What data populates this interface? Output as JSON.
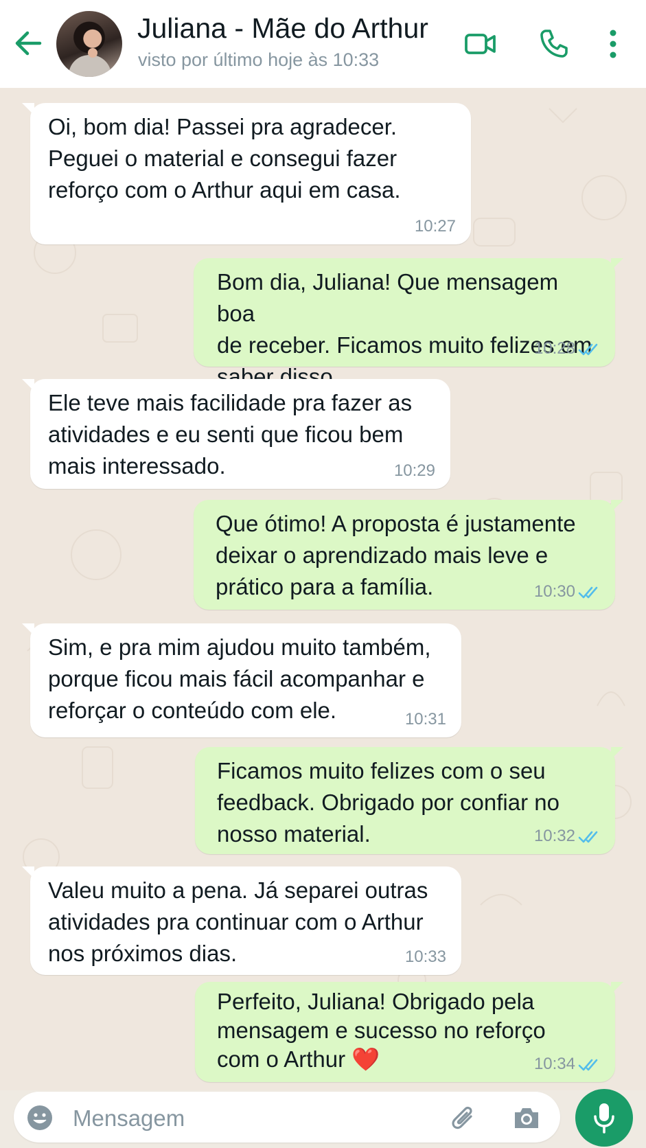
{
  "header": {
    "contact_name": "Juliana - Mãe do Arthur",
    "status": "visto por último hoje às 10:33"
  },
  "theme": {
    "accent": "#1a9c68",
    "incoming_bubble": "#ffffff",
    "outgoing_bubble": "#dcf8c6",
    "read_ticks": "#53bdeb"
  },
  "messages": [
    {
      "dir": "in",
      "text": "Oi, bom dia! Passei pra agradecer.\nPeguei o material e consegui fazer\nreforço com o Arthur aqui em casa.",
      "time": "10:27"
    },
    {
      "dir": "out",
      "text": "Bom dia, Juliana! Que mensagem boa\nde receber. Ficamos muito felizes em\nsaber disso.",
      "time": "10:28",
      "status": "read"
    },
    {
      "dir": "in",
      "text": "Ele teve mais facilidade pra fazer as\natividades e eu senti que ficou bem\nmais interessado.",
      "time": "10:29"
    },
    {
      "dir": "out",
      "text": "Que ótimo! A proposta é justamente\ndeixar o aprendizado mais leve e\nprático para a família.",
      "time": "10:30",
      "status": "read"
    },
    {
      "dir": "in",
      "text": "Sim, e pra mim ajudou muito também,\nporque ficou mais fácil acompanhar e\nreforçar o conteúdo com ele.",
      "time": "10:31"
    },
    {
      "dir": "out",
      "text": "Ficamos muito felizes com o seu\nfeedback. Obrigado por confiar no\nnosso material.",
      "time": "10:32",
      "status": "read"
    },
    {
      "dir": "in",
      "text": "Valeu muito a pena. Já separei outras\natividades pra continuar com o Arthur\nnos próximos dias.",
      "time": "10:33"
    },
    {
      "dir": "out",
      "text": "Perfeito, Juliana! Obrigado pela\nmensagem e sucesso no reforço\ncom o Arthur ❤️",
      "time": "10:34",
      "status": "read"
    }
  ],
  "composer": {
    "placeholder": "Mensagem"
  },
  "icons": {
    "back": "arrow-left-icon",
    "video": "video-camera-icon",
    "call": "phone-icon",
    "more": "more-vertical-icon",
    "emoji": "emoji-icon",
    "attach": "paperclip-icon",
    "camera": "camera-icon",
    "mic": "microphone-icon"
  }
}
